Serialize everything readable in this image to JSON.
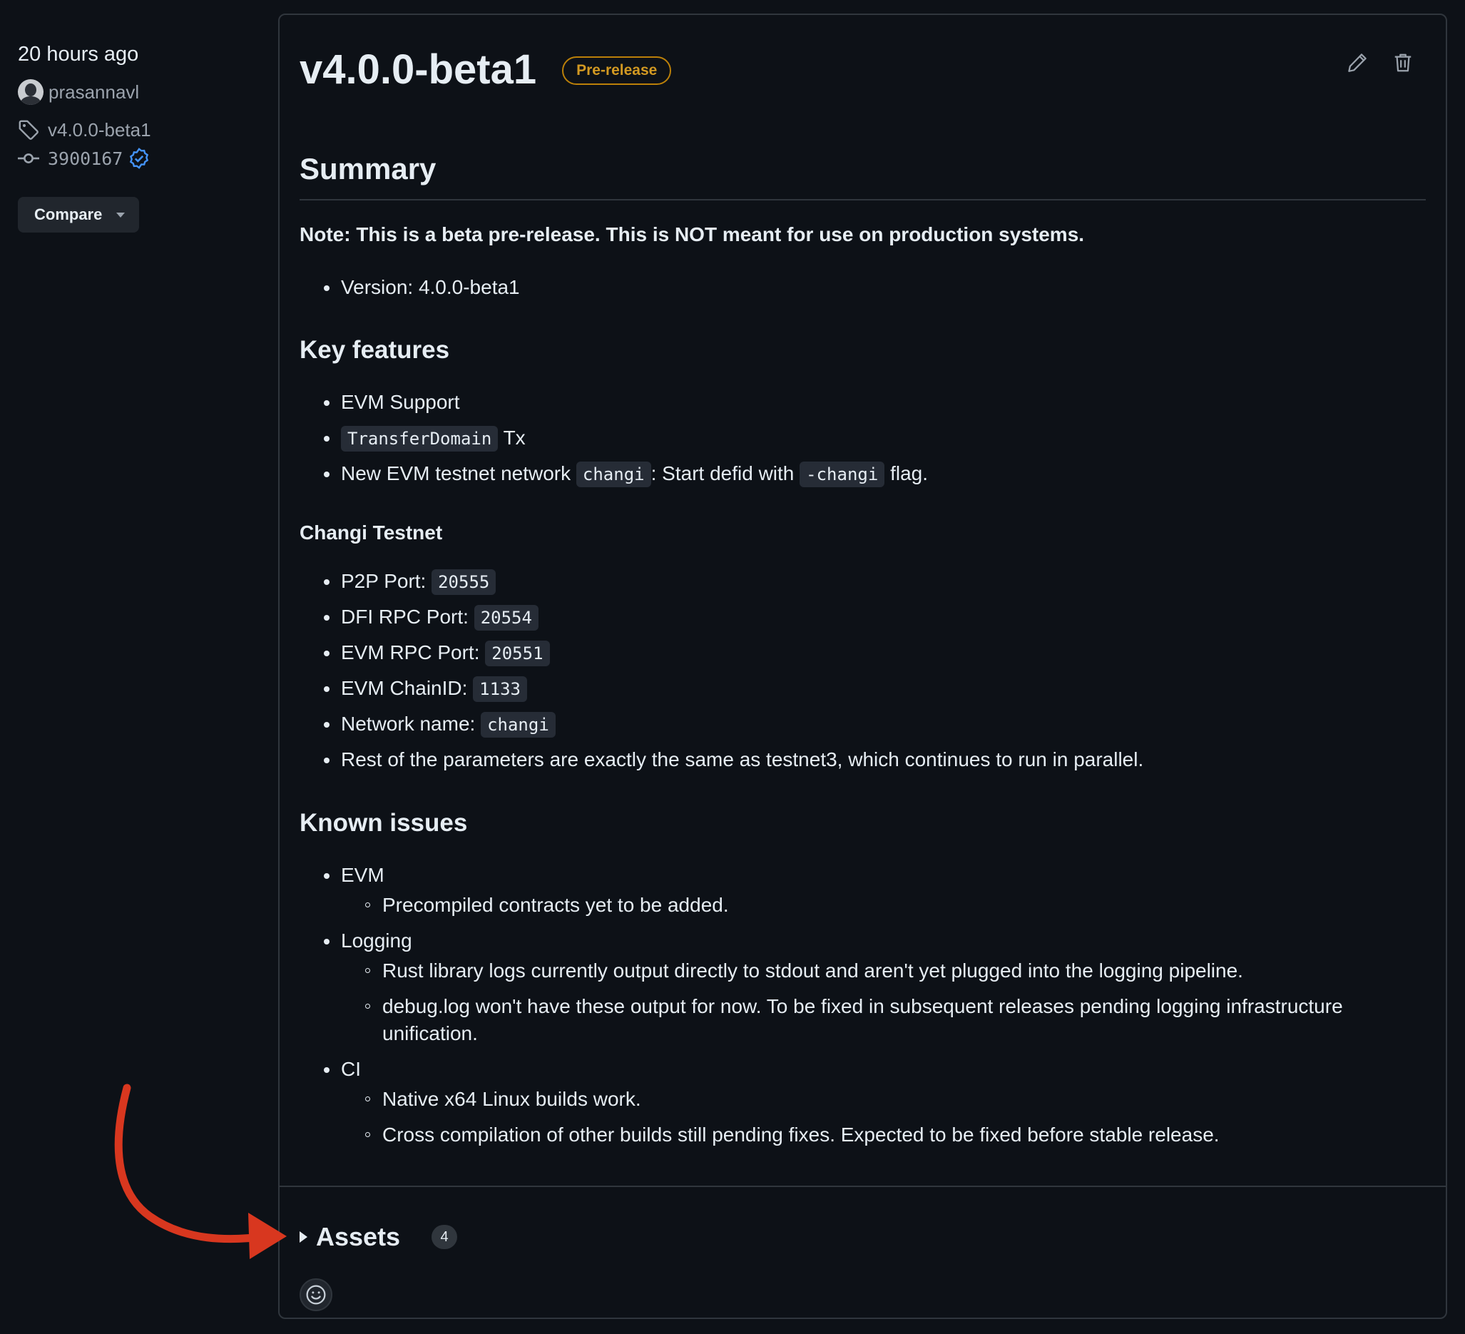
{
  "meta": {
    "time": "20 hours ago",
    "author": "prasannavl",
    "tag": "v4.0.0-beta1",
    "commit": "3900167",
    "compare_label": "Compare"
  },
  "release": {
    "title": "v4.0.0-beta1",
    "badge": "Pre-release",
    "summary_heading": "Summary",
    "note": "Note: This is a beta pre-release. This is NOT meant for use on production systems.",
    "version_item": "Version: 4.0.0-beta1",
    "key_features_heading": "Key features",
    "features": {
      "evm": "EVM Support",
      "transfer_code": "TransferDomain",
      "transfer_suffix": " Tx",
      "network_prefix": "New EVM testnet network ",
      "network_code": "changi",
      "network_mid": ": Start defid with ",
      "network_flag": "-changi",
      "network_suffix": " flag."
    },
    "changi_heading": "Changi Testnet",
    "changi": {
      "p2p_label": "P2P Port: ",
      "p2p_value": "20555",
      "dfi_label": "DFI RPC Port: ",
      "dfi_value": "20554",
      "evm_rpc_label": "EVM RPC Port: ",
      "evm_rpc_value": "20551",
      "chainid_label": "EVM ChainID: ",
      "chainid_value": "1133",
      "netname_label": "Network name: ",
      "netname_value": "changi",
      "rest": "Rest of the parameters are exactly the same as testnet3, which continues to run in parallel."
    },
    "known_issues_heading": "Known issues",
    "issues": {
      "evm": "EVM",
      "evm_sub1": "Precompiled contracts yet to be added.",
      "logging": "Logging",
      "logging_sub1": "Rust library logs currently output directly to stdout and aren't yet plugged into the logging pipeline.",
      "logging_sub2": "debug.log won't have these output for now. To be fixed in subsequent releases pending logging infrastructure unification.",
      "ci": "CI",
      "ci_sub1": "Native x64 Linux builds work.",
      "ci_sub2": "Cross compilation of other builds still pending fixes. Expected to be fixed before stable release."
    },
    "assets_label": "Assets",
    "assets_count": "4"
  },
  "icons": {
    "edit": "pencil-icon",
    "delete": "trash-icon",
    "tag": "tag-icon",
    "commit": "git-commit-icon",
    "verified": "verified-check-icon",
    "reaction": "smiley-icon"
  },
  "colors": {
    "background": "#0d1117",
    "prerelease": "#d29922",
    "verified": "#4493f8",
    "annotation_arrow": "#d8371f"
  }
}
